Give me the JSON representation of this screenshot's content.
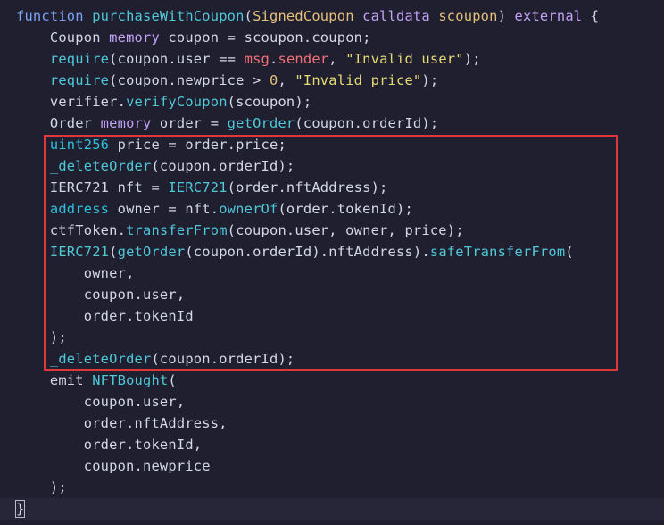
{
  "editor": {
    "lines": [
      [
        {
          "t": "function ",
          "c": "kw"
        },
        {
          "t": "purchaseWithCoupon",
          "c": "fn"
        },
        {
          "t": "(",
          "c": "pl"
        },
        {
          "t": "SignedCoupon",
          "c": "ty"
        },
        {
          "t": " ",
          "c": "pl"
        },
        {
          "t": "calldata",
          "c": "vi"
        },
        {
          "t": " ",
          "c": "pl"
        },
        {
          "t": "scoupon",
          "c": "ty"
        },
        {
          "t": ") ",
          "c": "pl"
        },
        {
          "t": "external",
          "c": "vi"
        },
        {
          "t": " {",
          "c": "pl"
        }
      ],
      [
        {
          "t": "    Coupon ",
          "c": "pl"
        },
        {
          "t": "memory",
          "c": "vi"
        },
        {
          "t": " coupon = scoupon.coupon;",
          "c": "pl"
        }
      ],
      [
        {
          "t": "    ",
          "c": "pl"
        },
        {
          "t": "require",
          "c": "fn"
        },
        {
          "t": "(coupon.user == ",
          "c": "pl"
        },
        {
          "t": "msg",
          "c": "spec"
        },
        {
          "t": ".",
          "c": "pl"
        },
        {
          "t": "sender",
          "c": "spec"
        },
        {
          "t": ", ",
          "c": "pl"
        },
        {
          "t": "\"Invalid user\"",
          "c": "st"
        },
        {
          "t": ");",
          "c": "pl"
        }
      ],
      [
        {
          "t": "    ",
          "c": "pl"
        },
        {
          "t": "require",
          "c": "fn"
        },
        {
          "t": "(coupon.newprice > ",
          "c": "pl"
        },
        {
          "t": "0",
          "c": "nu"
        },
        {
          "t": ", ",
          "c": "pl"
        },
        {
          "t": "\"Invalid price\"",
          "c": "st"
        },
        {
          "t": ");",
          "c": "pl"
        }
      ],
      [
        {
          "t": "    verifier.",
          "c": "pl"
        },
        {
          "t": "verifyCoupon",
          "c": "fn"
        },
        {
          "t": "(scoupon);",
          "c": "pl"
        }
      ],
      [
        {
          "t": "    Order ",
          "c": "pl"
        },
        {
          "t": "memory",
          "c": "vi"
        },
        {
          "t": " order = ",
          "c": "pl"
        },
        {
          "t": "getOrder",
          "c": "fn"
        },
        {
          "t": "(coupon.orderId);",
          "c": "pl"
        }
      ],
      [
        {
          "t": "    ",
          "c": "pl"
        },
        {
          "t": "uint256",
          "c": "cy"
        },
        {
          "t": " price = order.price;",
          "c": "pl"
        }
      ],
      [
        {
          "t": "    ",
          "c": "pl"
        },
        {
          "t": "_deleteOrder",
          "c": "fn"
        },
        {
          "t": "(coupon.orderId);",
          "c": "pl"
        }
      ],
      [
        {
          "t": "    IERC721 nft = ",
          "c": "pl"
        },
        {
          "t": "IERC721",
          "c": "fn"
        },
        {
          "t": "(order.nftAddress);",
          "c": "pl"
        }
      ],
      [
        {
          "t": "    ",
          "c": "pl"
        },
        {
          "t": "address",
          "c": "cy"
        },
        {
          "t": " owner = nft.",
          "c": "pl"
        },
        {
          "t": "ownerOf",
          "c": "fn"
        },
        {
          "t": "(order.tokenId);",
          "c": "pl"
        }
      ],
      [
        {
          "t": "    ctfToken.",
          "c": "pl"
        },
        {
          "t": "transferFrom",
          "c": "fn"
        },
        {
          "t": "(coupon.user, owner, price);",
          "c": "pl"
        }
      ],
      [
        {
          "t": "    ",
          "c": "pl"
        },
        {
          "t": "IERC721",
          "c": "fn"
        },
        {
          "t": "(",
          "c": "pl"
        },
        {
          "t": "getOrder",
          "c": "fn"
        },
        {
          "t": "(coupon.orderId).nftAddress).",
          "c": "pl"
        },
        {
          "t": "safeTransferFrom",
          "c": "fn"
        },
        {
          "t": "(",
          "c": "pl"
        }
      ],
      [
        {
          "t": "        owner,",
          "c": "pl"
        }
      ],
      [
        {
          "t": "        coupon.user,",
          "c": "pl"
        }
      ],
      [
        {
          "t": "        order.tokenId",
          "c": "pl"
        }
      ],
      [
        {
          "t": "    );",
          "c": "pl"
        }
      ],
      [
        {
          "t": "    ",
          "c": "pl"
        },
        {
          "t": "_deleteOrder",
          "c": "fn"
        },
        {
          "t": "(coupon.orderId);",
          "c": "pl"
        }
      ],
      [
        {
          "t": "    emit ",
          "c": "pl"
        },
        {
          "t": "NFTBought",
          "c": "fn"
        },
        {
          "t": "(",
          "c": "pl"
        }
      ],
      [
        {
          "t": "        coupon.user,",
          "c": "pl"
        }
      ],
      [
        {
          "t": "        order.nftAddress,",
          "c": "pl"
        }
      ],
      [
        {
          "t": "        order.tokenId,",
          "c": "pl"
        }
      ],
      [
        {
          "t": "        coupon.newprice",
          "c": "pl"
        }
      ],
      [
        {
          "t": "    );",
          "c": "pl"
        }
      ]
    ],
    "closing_brace": "}"
  },
  "colors": {
    "background": "#1f1f30",
    "highlight_box": "#e0383a",
    "keyword": "#7aa2f7",
    "function": "#4fc8d8",
    "type": "#e6c07b",
    "string": "#e6db74",
    "storage": "#c3a1f5",
    "special": "#f07178",
    "builtin_type": "#2ec1dc",
    "plain": "#d4d7e6"
  }
}
